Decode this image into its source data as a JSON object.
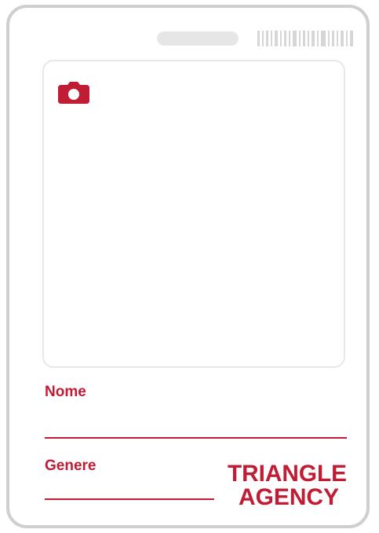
{
  "card": {
    "accent_color": "#c01c33",
    "border_color": "#cfcfcf",
    "camera_icon": "camera-icon",
    "fields": {
      "name_label": "Nome",
      "name_value": "",
      "genre_label": "Genere",
      "genre_value": ""
    },
    "logo": {
      "line1": "TRIANGLE",
      "line2": "AGENCY"
    }
  }
}
